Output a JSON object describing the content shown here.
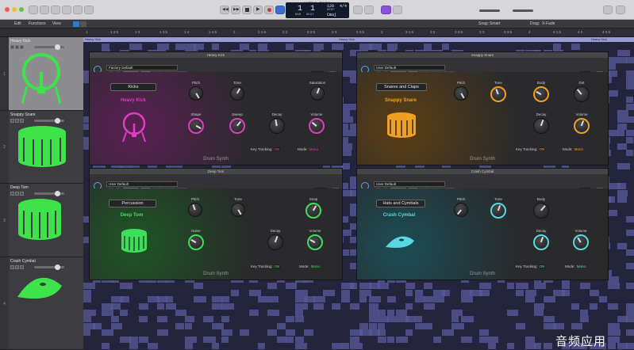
{
  "window": {
    "title": "Untitled - Tracks"
  },
  "lcd": {
    "position": "1  1",
    "bar_label": "BAR",
    "beat_label": "BEAT",
    "tempo": "120",
    "tempo_label": "KEEP",
    "signature": "4/4",
    "key": "Cmaj"
  },
  "toolbar": {
    "edit": "Edit",
    "functions": "Functions",
    "view": "View",
    "snap_label": "Snap:",
    "snap_value": "Smart",
    "drag_label": "Drag:",
    "drag_value": "X-Fade"
  },
  "ruler": {
    "marks": [
      "1",
      "1 2.5",
      "1 3",
      "1 3.5",
      "1 4",
      "1 4.5",
      "2",
      "2 1.5",
      "2 2",
      "2 2.5",
      "2 3",
      "2 3.5",
      "3",
      "3 1.5",
      "3 2",
      "3 2.5",
      "3 3",
      "3 3.5",
      "4",
      "4 1.5",
      "4 2",
      "4 2.5"
    ]
  },
  "tracks": [
    {
      "num": "1",
      "name": "Heavy Kick",
      "selected": true
    },
    {
      "num": "2",
      "name": "Snappy Snare",
      "selected": false
    },
    {
      "num": "3",
      "name": "Deep Tom",
      "selected": false
    },
    {
      "num": "4",
      "name": "Crash Cymbal",
      "selected": false
    }
  ],
  "regions": {
    "top1": "Heavy Kick",
    "top2": "Heavy Kick",
    "top3": "Heavy Kick"
  },
  "plugins": {
    "kick": {
      "header": "Heavy Kick",
      "preset": "Factory Default",
      "category": "Kicks",
      "sound": "Heavy Kick",
      "color": "#e03cc0",
      "view_label": "View:",
      "view_value": "95%",
      "buttons": [
        "<",
        ">",
        "Compare",
        "Copy",
        "Paste",
        "Undo",
        "Redo"
      ],
      "knobs": [
        "Pitch",
        "Tone",
        "Saturation",
        "Shape",
        "Sweep",
        "Decay",
        "Volume"
      ],
      "key_tracking": "Key Tracking:",
      "key_tracking_value": "ON",
      "mode": "Mode:",
      "mode_value": "Mono",
      "footer": "Drum Synth"
    },
    "snare": {
      "header": "Snappy Snare",
      "preset": "User Default",
      "category": "Snares and Claps",
      "sound": "Snappy Snare",
      "color": "#f0a020",
      "view_label": "View:",
      "view_value": "95%",
      "buttons": [
        "<",
        ">",
        "Compare",
        "Copy",
        "Paste",
        "Undo",
        "Redo"
      ],
      "knobs": [
        "Pitch",
        "Tone",
        "Body",
        "Dirt",
        "Decay",
        "Volume"
      ],
      "key_tracking": "Key Tracking:",
      "key_tracking_value": "ON",
      "mode": "Mode:",
      "mode_value": "Mono",
      "footer": "Drum Synth"
    },
    "tom": {
      "header": "Deep Tom",
      "preset": "User Default",
      "category": "Percussion",
      "sound": "Deep Tom",
      "color": "#3ce05a",
      "view_label": "View:",
      "view_value": "100%",
      "buttons": [
        "<",
        ">",
        "Compare",
        "Copy",
        "Paste",
        "Undo",
        "Redo"
      ],
      "knobs": [
        "Pitch",
        "Tone",
        "Snap",
        "Noise",
        "Decay",
        "Volume"
      ],
      "key_tracking": "Key Tracking:",
      "key_tracking_value": "ON",
      "mode": "Mode:",
      "mode_value": "Mono",
      "footer": "Drum Synth"
    },
    "cymbal": {
      "header": "Crash Cymbal",
      "preset": "User Default",
      "category": "Hats and Cymbals",
      "sound": "Crash Cymbal",
      "color": "#58d8e0",
      "view_label": "View:",
      "view_value": "98%",
      "buttons": [
        "<",
        ">",
        "Compare",
        "Copy",
        "Paste",
        "Undo",
        "Redo"
      ],
      "knobs": [
        "Pitch",
        "Tone",
        "Body",
        "Decay",
        "Volume"
      ],
      "key_tracking": "Key Tracking:",
      "key_tracking_value": "ON",
      "mode": "Mode:",
      "mode_value": "Mono",
      "footer": "Drum Synth"
    }
  },
  "watermark": "音频应用",
  "colors": {
    "kick": "#e03cc0",
    "snare": "#f0a020",
    "tom": "#3ce05a",
    "cymbal": "#58d8e0",
    "track_icon": "#3ee24a",
    "region": "#5a5a9e"
  }
}
